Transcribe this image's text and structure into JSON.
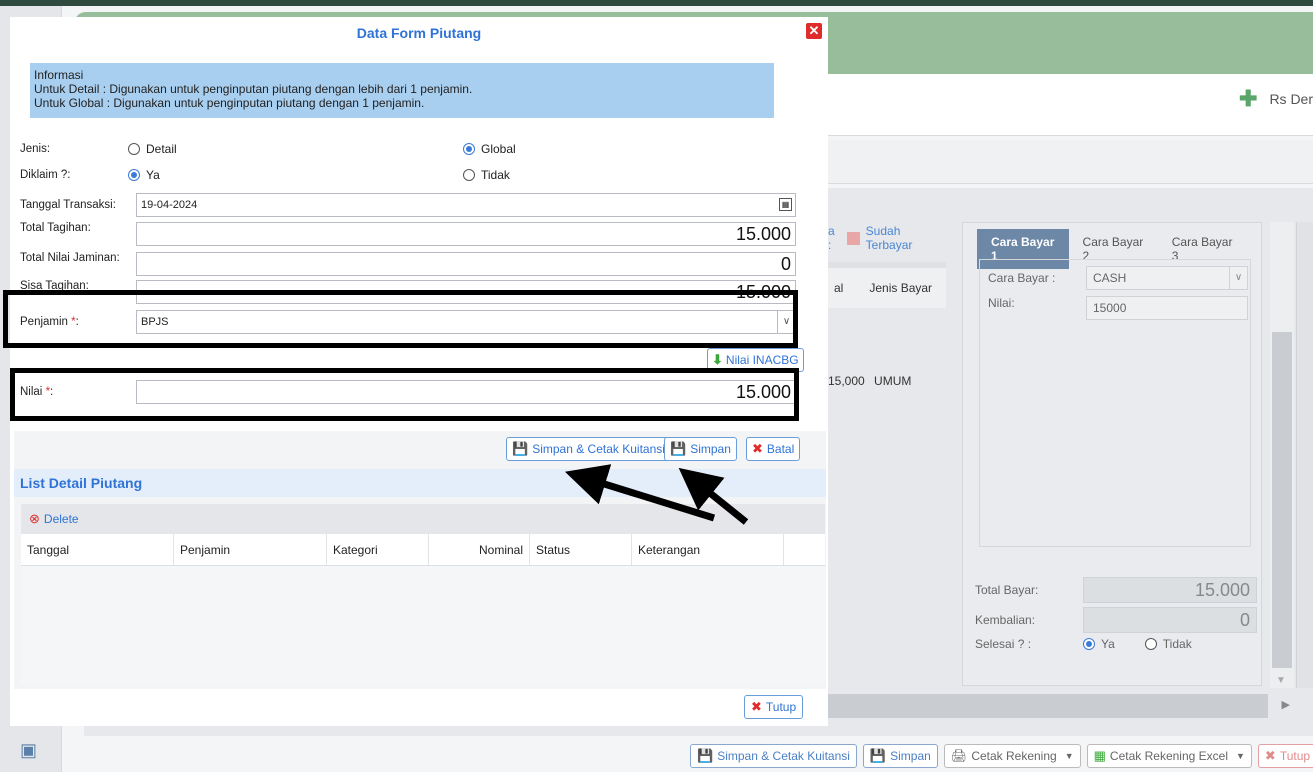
{
  "background": {
    "hospital_name": "Rs Der",
    "legend_partial": "a :",
    "legend_paid": "Sudah Terbayar",
    "grid_col1": "al",
    "grid_col2": "Jenis Bayar",
    "grid_row_value": "15,000",
    "grid_row_type": "UMUM",
    "pay_tabs": [
      "Cara Bayar 1",
      "Cara Bayar 2",
      "Cara Bayar 3"
    ],
    "cara_bayar_label": "Cara Bayar :",
    "cara_bayar_value": "CASH",
    "nilai_label": "Nilai:",
    "nilai_value": "15000",
    "total_bayar_label": "Total Bayar:",
    "total_bayar_value": "15.000",
    "kembalian_label": "Kembalian:",
    "kembalian_value": "0",
    "selesai_label": "Selesai ? :",
    "selesai_ya": "Ya",
    "selesai_tidak": "Tidak",
    "bottom_buttons": {
      "simpan_cetak": "Simpan & Cetak Kuitansi",
      "simpan": "Simpan",
      "cetak_rekening": "Cetak Rekening",
      "cetak_rekening_excel": "Cetak Rekening Excel",
      "tutup": "Tutup"
    }
  },
  "modal": {
    "title": "Data Form Piutang",
    "info": {
      "heading": "Informasi",
      "line1": "Untuk Detail : Digunakan untuk penginputan piutang dengan lebih dari 1 penjamin.",
      "line2": "Untuk Global : Digunakan untuk penginputan piutang dengan 1 penjamin."
    },
    "jenis_label": "Jenis:",
    "jenis_detail": "Detail",
    "jenis_global": "Global",
    "jenis_selected": "Global",
    "diklaim_label": "Diklaim ?:",
    "diklaim_ya": "Ya",
    "diklaim_tidak": "Tidak",
    "diklaim_selected": "Ya",
    "tanggal_label": "Tanggal Transaksi:",
    "tanggal_value": "19-04-2024",
    "total_tagihan_label": "Total Tagihan:",
    "total_tagihan_value": "15.000",
    "total_jaminan_label": "Total Nilai Jaminan:",
    "total_jaminan_value": "0",
    "sisa_tagihan_label": "Sisa Tagihan:",
    "sisa_tagihan_value": "15.000",
    "penjamin_label": "Penjamin ",
    "penjamin_value": "BPJS",
    "nilai_inacbg_label": "Nilai INACBG",
    "nilai_label": "Nilai ",
    "nilai_value": "15.000",
    "required_mark": "*",
    "colon": ":",
    "buttons": {
      "simpan_cetak": "Simpan & Cetak Kuitansi",
      "simpan": "Simpan",
      "batal": "Batal",
      "tutup": "Tutup"
    },
    "list": {
      "title": "List Detail Piutang",
      "delete_label": "Delete",
      "columns": [
        "Tanggal",
        "Penjamin",
        "Kategori",
        "Nominal",
        "Status",
        "Keterangan"
      ]
    }
  },
  "colors": {
    "accent_blue": "#2f73d6",
    "header_green": "#98bd9a",
    "info_blue": "#a9cff0",
    "danger_red": "#e02b2b"
  }
}
